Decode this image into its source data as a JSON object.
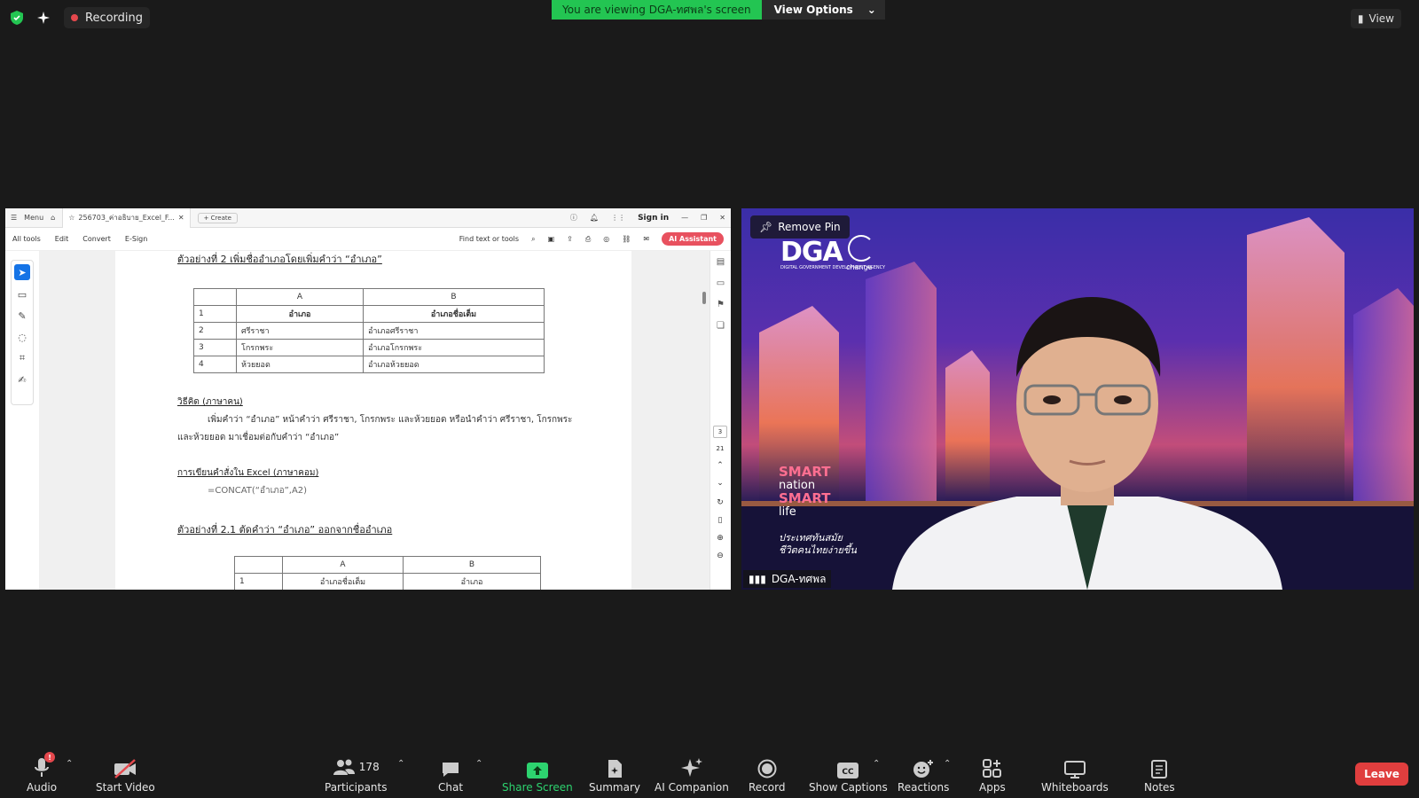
{
  "topbar": {
    "recording_label": "Recording",
    "viewing_banner": "You are viewing DGA-ทศพล's screen",
    "view_options_label": "View Options",
    "view_label": "View"
  },
  "acrobat": {
    "menu_label": "Menu",
    "tab_title": "256703_ค่าอธิบาย_Excel_F...",
    "create_label": "Create",
    "sign_in_label": "Sign in",
    "tools": [
      "All tools",
      "Edit",
      "Convert",
      "E-Sign"
    ],
    "find_placeholder": "Find text or tools",
    "ai_assistant_label": "AI Assistant",
    "page_current": "3",
    "page_total": "21"
  },
  "document": {
    "heading1": "ตัวอย่างที่ 2 เพิ่มชื่ออำเภอโดยเพิ่มคำว่า “อำเภอ”",
    "table1": {
      "columns": [
        "",
        "A",
        "B"
      ],
      "rows": [
        [
          "1",
          "อำเภอ",
          "อำเภอชื่อเต็ม"
        ],
        [
          "2",
          "ศรีราชา",
          "อำเภอศรีราชา"
        ],
        [
          "3",
          "โกรกพระ",
          "อำเภอโกรกพระ"
        ],
        [
          "4",
          "ห้วยยอด",
          "อำเภอห้วยยอด"
        ]
      ]
    },
    "method_heading": "วิธีคิด (ภาษาคน)",
    "method_line1": "เพิ่มคำว่า “อำเภอ” หน้าคำว่า ศรีราชา, โกรกพระ และห้วยยอด หรือนำคำว่า ศรีราชา, โกรกพระ",
    "method_line2": "และห้วยยอด มาเชื่อมต่อกับคำว่า “อำเภอ”",
    "excel_heading": "การเขียนคำสั่งใน Excel (ภาษาคอม)",
    "formula": "=CONCAT(“อำเภอ”,A2)",
    "heading2": "ตัวอย่างที่ 2.1 ตัดคำว่า “อำเภอ” ออกจากชื่ออำเภอ",
    "table2": {
      "columns": [
        "",
        "A",
        "B"
      ],
      "rows": [
        [
          "1",
          "อำเภอชื่อเต็ม",
          "อำเภอ"
        ]
      ]
    }
  },
  "video": {
    "remove_pin_label": "Remove Pin",
    "logo_text": "DGA",
    "logo_subtext": "DIGITAL GOVERNMENT DEVELOPMENT AGENCY",
    "change_label": "change",
    "smart_line1": "SMART",
    "smart_line2": "nation",
    "smart_line3": "SMART",
    "smart_line4": "life",
    "slogan_line1": "ประเทศทันสมัย",
    "slogan_line2": "ชีวิตคนไทยง่ายขึ้น",
    "participant_name": "DGA-ทศพล"
  },
  "toolbar": {
    "audio_label": "Audio",
    "start_video_label": "Start Video",
    "participants_label": "Participants",
    "participants_count": "178",
    "chat_label": "Chat",
    "share_screen_label": "Share Screen",
    "summary_label": "Summary",
    "ai_companion_label": "AI Companion",
    "record_label": "Record",
    "show_captions_label": "Show Captions",
    "reactions_label": "Reactions",
    "apps_label": "Apps",
    "whiteboards_label": "Whiteboards",
    "notes_label": "Notes",
    "leave_label": "Leave"
  },
  "colors": {
    "accent_green": "#23c552",
    "leave_red": "#e03e3e",
    "acrobat_blue": "#1473e6"
  }
}
